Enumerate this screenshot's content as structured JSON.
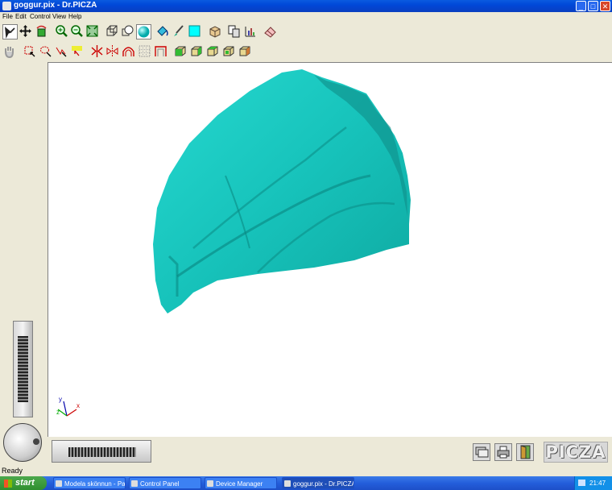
{
  "window": {
    "title": "goggur.pix - Dr.PICZA"
  },
  "window_buttons": {
    "minimize": "_",
    "maximize": "□",
    "close": "✕"
  },
  "menu": [
    "File",
    "Edit",
    "Control",
    "View",
    "Help"
  ],
  "toolbar1": [
    {
      "name": "pointer-tool",
      "icon": "pointer-icon"
    },
    {
      "name": "move-tool",
      "icon": "move-cross-icon"
    },
    {
      "name": "rotate-tool",
      "icon": "rotate-cube-icon"
    },
    {
      "name": "zoom-in-tool",
      "icon": "zoom-in-icon"
    },
    {
      "name": "zoom-out-tool",
      "icon": "zoom-out-icon"
    },
    {
      "name": "fit-view-tool",
      "icon": "fit-view-icon"
    },
    {
      "name": "wireframe-tool",
      "icon": "wireframe-icon"
    },
    {
      "name": "shaded-tool",
      "icon": "shaded-sphere-icon"
    },
    {
      "name": "render-sphere-tool",
      "icon": "cyan-sphere-icon"
    },
    {
      "name": "paint-bucket-tool",
      "icon": "paint-bucket-icon"
    },
    {
      "name": "brush-tool",
      "icon": "brush-icon"
    },
    {
      "name": "color-tool",
      "icon": "cyan-square-icon"
    },
    {
      "name": "box-tool",
      "icon": "box-icon"
    },
    {
      "name": "copy-tool",
      "icon": "copy-icon"
    },
    {
      "name": "measure-tool",
      "icon": "measure-icon"
    },
    {
      "name": "eraser-tool",
      "icon": "eraser-icon"
    }
  ],
  "toolbar2": [
    {
      "name": "hand-tool",
      "icon": "hand-icon"
    },
    {
      "name": "select-rect-tool",
      "icon": "select-rect-icon"
    },
    {
      "name": "select-lasso-tool",
      "icon": "select-lasso-icon"
    },
    {
      "name": "select-point-tool",
      "icon": "select-point-icon"
    },
    {
      "name": "select-label-tool",
      "icon": "select-label-icon"
    },
    {
      "name": "split-tool",
      "icon": "split-icon"
    },
    {
      "name": "mirror-tool",
      "icon": "mirror-icon"
    },
    {
      "name": "arch-tool",
      "icon": "arch-icon"
    },
    {
      "name": "grid-tool",
      "icon": "grid-icon"
    },
    {
      "name": "frame-tool",
      "icon": "frame-icon"
    },
    {
      "name": "view-front-tool",
      "icon": "cube-view-icon"
    },
    {
      "name": "view-left-tool",
      "icon": "cube-view-icon"
    },
    {
      "name": "view-top-tool",
      "icon": "cube-view-icon"
    },
    {
      "name": "view-right-tool",
      "icon": "cube-view-icon"
    },
    {
      "name": "view-back-tool",
      "icon": "cube-view-icon"
    }
  ],
  "axes": {
    "y": "y",
    "x": "x",
    "z": "z"
  },
  "colors": {
    "model": "#17cdc4",
    "model_dark": "#0a9a94",
    "accent": "#00ffff"
  },
  "logo": "PICZA",
  "status": "Ready",
  "taskbar": {
    "start": "start",
    "tasks": [
      "Modela skönnun - Pa...",
      "Control Panel",
      "Device Manager",
      "goggur.pix - Dr.PICZA"
    ],
    "clock": "21:47"
  }
}
